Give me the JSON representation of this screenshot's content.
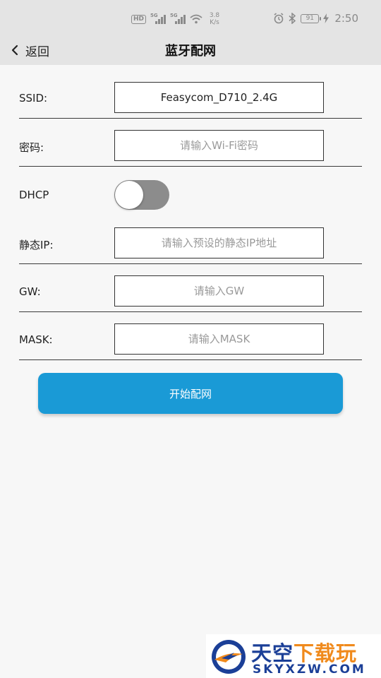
{
  "status_bar": {
    "hd_badge": "HD",
    "sim1_gen": "5G",
    "sim2_gen": "5G",
    "net_speed": "3.8",
    "net_speed_unit": "K/s",
    "battery": "91",
    "time": "2:50"
  },
  "header": {
    "back_label": "返回",
    "title": "蓝牙配网"
  },
  "form": {
    "ssid_label": "SSID:",
    "ssid_value": "Feasycom_D710_2.4G",
    "password_label": "密码:",
    "password_placeholder": "请输入Wi-Fi密码",
    "dhcp_label": "DHCP",
    "dhcp_enabled": false,
    "static_ip_label": "静态IP:",
    "static_ip_placeholder": "请输入预设的静态IP地址",
    "gw_label": "GW:",
    "gw_placeholder": "请输入GW",
    "mask_label": "MASK:",
    "mask_placeholder": "请输入MASK"
  },
  "start_button_label": "开始配网",
  "watermark": {
    "title_part1": "天空",
    "title_part2": "下载玩",
    "subtitle": "SKYXZW.COM"
  },
  "colors": {
    "accent": "#1a9ad6",
    "header_bg": "#e4e4e4",
    "page_bg": "#f7f7f7",
    "toggle_off": "#8c8c8c"
  }
}
